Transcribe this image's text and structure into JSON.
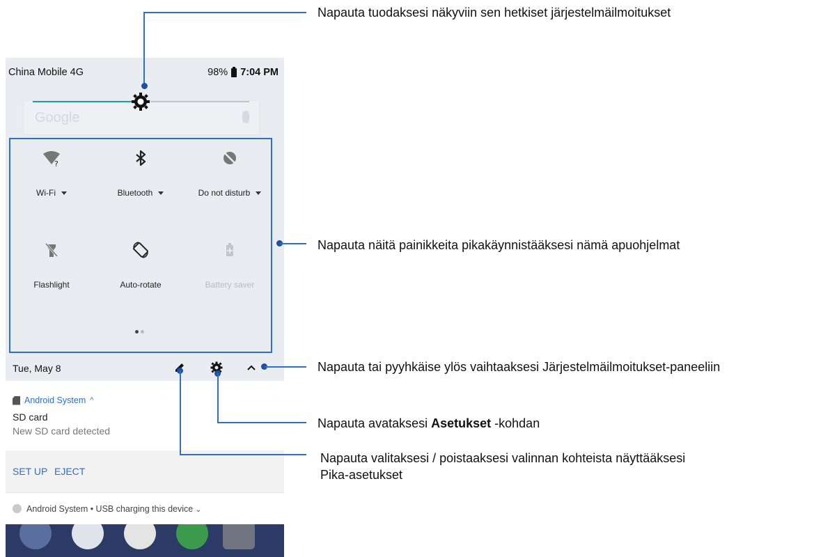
{
  "status_bar": {
    "carrier": "China Mobile 4G",
    "battery": "98%",
    "time": "7:04 PM"
  },
  "search": {
    "placeholder": "Google"
  },
  "brightness": {
    "level_percent": 48
  },
  "quick_tiles": [
    {
      "label": "Wi-Fi",
      "icon": "wifi-unknown-icon",
      "dropdown": true,
      "enabled": true
    },
    {
      "label": "Bluetooth",
      "icon": "bluetooth-icon",
      "dropdown": true,
      "enabled": true
    },
    {
      "label": "Do not disturb",
      "icon": "do-not-disturb-icon",
      "dropdown": true,
      "enabled": true
    },
    {
      "label": "Flashlight",
      "icon": "flashlight-off-icon",
      "dropdown": false,
      "enabled": true
    },
    {
      "label": "Auto-rotate",
      "icon": "auto-rotate-icon",
      "dropdown": false,
      "enabled": true
    },
    {
      "label": "Battery saver",
      "icon": "battery-saver-icon",
      "dropdown": false,
      "enabled": false
    }
  ],
  "page_indicator": {
    "pages": 2,
    "current": 1
  },
  "date_bar": {
    "date": "Tue, May 8"
  },
  "notification": {
    "app": "Android System",
    "title": "SD card",
    "text": "New SD card detected",
    "actions": [
      "SET UP",
      "EJECT"
    ]
  },
  "usb_notification": {
    "text": "Android System • USB charging this device"
  },
  "annotations": {
    "brightness": "Napauta tuodaksesi näkyviin sen hetkiset järjestelmäilmoitukset",
    "tiles": "Napauta näitä painikkeita pikakäynnistääksesi nämä apuohjelmat",
    "collapse": "Napauta tai pyyhkäise ylös vaihtaaksesi Järjestelmäilmoitukset-paneeliin",
    "settings_prefix": "Napauta avataksesi ",
    "settings_bold": "Asetukset",
    "settings_suffix": " -kohdan",
    "edit_line1": "Napauta valitaksesi / poistaaksesi valinnan kohteista näyttääksesi",
    "edit_line2": "Pika-asetukset"
  },
  "colors": {
    "panel_bg": "#e9ecf1",
    "accent": "#1f9d99",
    "callout": "#2b70c3",
    "link": "#2f6fbf"
  }
}
